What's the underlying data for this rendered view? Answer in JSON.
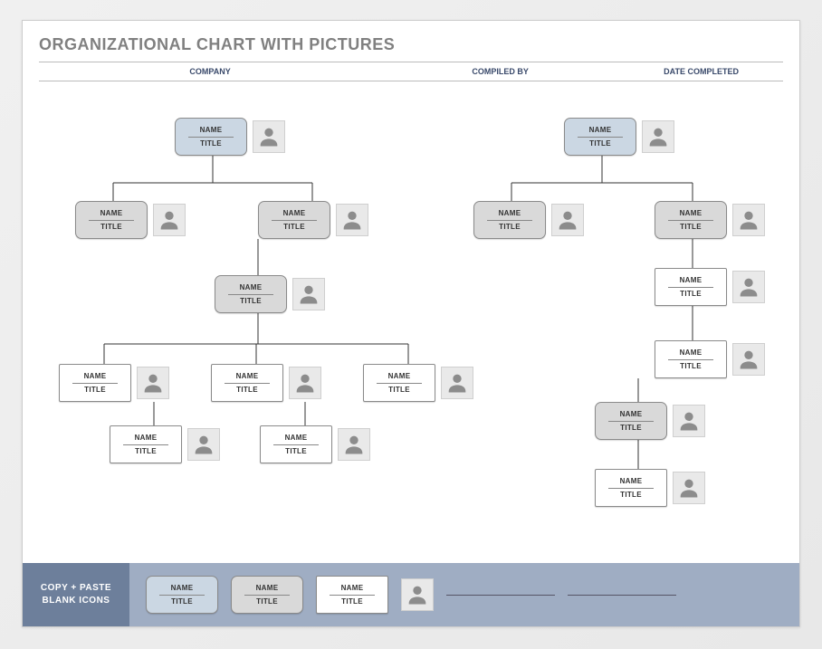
{
  "page": {
    "title": "ORGANIZATIONAL CHART WITH PICTURES"
  },
  "header_fields": {
    "company_label": "COMPANY",
    "compiled_by_label": "COMPILED BY",
    "date_completed_label": "DATE COMPLETED"
  },
  "placeholders": {
    "name": "NAME",
    "title": "TITLE"
  },
  "footer": {
    "label_line1": "COPY + PASTE",
    "label_line2": "BLANK ICONS"
  },
  "nodes": {
    "left_root": {
      "name": "NAME",
      "title": "TITLE",
      "style": "blue"
    },
    "left_l2_a": {
      "name": "NAME",
      "title": "TITLE",
      "style": "grey"
    },
    "left_l2_b": {
      "name": "NAME",
      "title": "TITLE",
      "style": "grey"
    },
    "left_l3": {
      "name": "NAME",
      "title": "TITLE",
      "style": "grey"
    },
    "left_l4_a": {
      "name": "NAME",
      "title": "TITLE",
      "style": "white"
    },
    "left_l4_b": {
      "name": "NAME",
      "title": "TITLE",
      "style": "white"
    },
    "left_l4_c": {
      "name": "NAME",
      "title": "TITLE",
      "style": "white"
    },
    "left_l5_a": {
      "name": "NAME",
      "title": "TITLE",
      "style": "white"
    },
    "left_l5_b": {
      "name": "NAME",
      "title": "TITLE",
      "style": "white"
    },
    "right_root": {
      "name": "NAME",
      "title": "TITLE",
      "style": "blue"
    },
    "right_l2_a": {
      "name": "NAME",
      "title": "TITLE",
      "style": "grey"
    },
    "right_l2_b": {
      "name": "NAME",
      "title": "TITLE",
      "style": "grey"
    },
    "right_l3": {
      "name": "NAME",
      "title": "TITLE",
      "style": "white"
    },
    "right_l4": {
      "name": "NAME",
      "title": "TITLE",
      "style": "white"
    },
    "right_l5": {
      "name": "NAME",
      "title": "TITLE",
      "style": "grey"
    },
    "right_l6": {
      "name": "NAME",
      "title": "TITLE",
      "style": "white"
    },
    "footer_blue": {
      "name": "NAME",
      "title": "TITLE",
      "style": "blue"
    },
    "footer_grey": {
      "name": "NAME",
      "title": "TITLE",
      "style": "grey"
    },
    "footer_white": {
      "name": "NAME",
      "title": "TITLE",
      "style": "white"
    }
  }
}
